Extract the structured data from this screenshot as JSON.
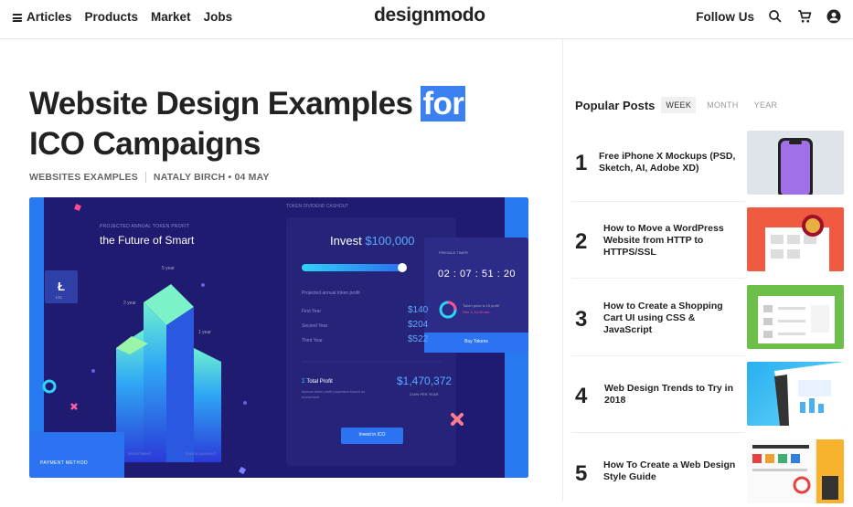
{
  "nav": {
    "left_items": [
      "Articles",
      "Products",
      "Market",
      "Jobs"
    ],
    "logo": "designmodo",
    "follow_label": "Follow Us"
  },
  "article": {
    "title_line1": "Website Design Examples ",
    "title_highlight": "for",
    "title_line2": "ICO Campaigns",
    "category": "WEBSITES EXAMPLES",
    "author_date": "NATALY BIRCH • 04 MAY"
  },
  "hero": {
    "tagline_small": "PROJECTED ANNUAL TOKEN PROFIT",
    "tagline": "the Future of Smart",
    "label_5year": "5 year",
    "label_2year": "2 year",
    "label_1year": "1 year",
    "coin": "LTC",
    "invest_label": "Invest",
    "invest_amount": "$100,000",
    "projected_label": "Projected annual token profit",
    "first_year": "First Year",
    "first_val": "$140",
    "second_year": "Second Year",
    "second_val": "$204",
    "third_year": "Third Year",
    "third_val": "$522",
    "total_label": "Total Profit",
    "total_value": "$1,470,372",
    "total_sub": "Annual token profit projection based on investment",
    "total_pct": "216% PER YEAR",
    "invest_button": "Invest in ICO",
    "timer_title": "PRESALE TIMER",
    "timer": [
      "02",
      "07",
      "51",
      "20"
    ],
    "timer_sep": ":",
    "timer_note": "Token price is 15 profit",
    "timer_date": "Dec 3, 12:00 am",
    "buy_button": "Buy Tokens",
    "top_label": "TOKEN DIVIDEND CASHOUT",
    "payment_method": "PAYMENT METHOD",
    "investment": "INVESTMENT",
    "token_cashout": "TOKEN CASHOUT"
  },
  "popular": {
    "title": "Popular Posts",
    "tabs": [
      "WEEK",
      "MONTH",
      "YEAR"
    ],
    "active_tab": "WEEK",
    "posts": [
      {
        "num": "1",
        "title": "Free iPhone X Mockups (PSD, Sketch, AI, Adobe XD)"
      },
      {
        "num": "2",
        "title": "How to Move a WordPress Website from HTTP to HTTPS/SSL"
      },
      {
        "num": "3",
        "title": "How to Create a Shopping Cart UI using CSS & JavaScript"
      },
      {
        "num": "4",
        "title": "Web Design Trends to Try in 2018"
      },
      {
        "num": "5",
        "title": "How To Create a Web Design Style Guide"
      }
    ]
  },
  "colors": {
    "accent": "#3b80f0",
    "hero_bg": "#1d1b6e",
    "hero_panel": "#2a2880"
  }
}
